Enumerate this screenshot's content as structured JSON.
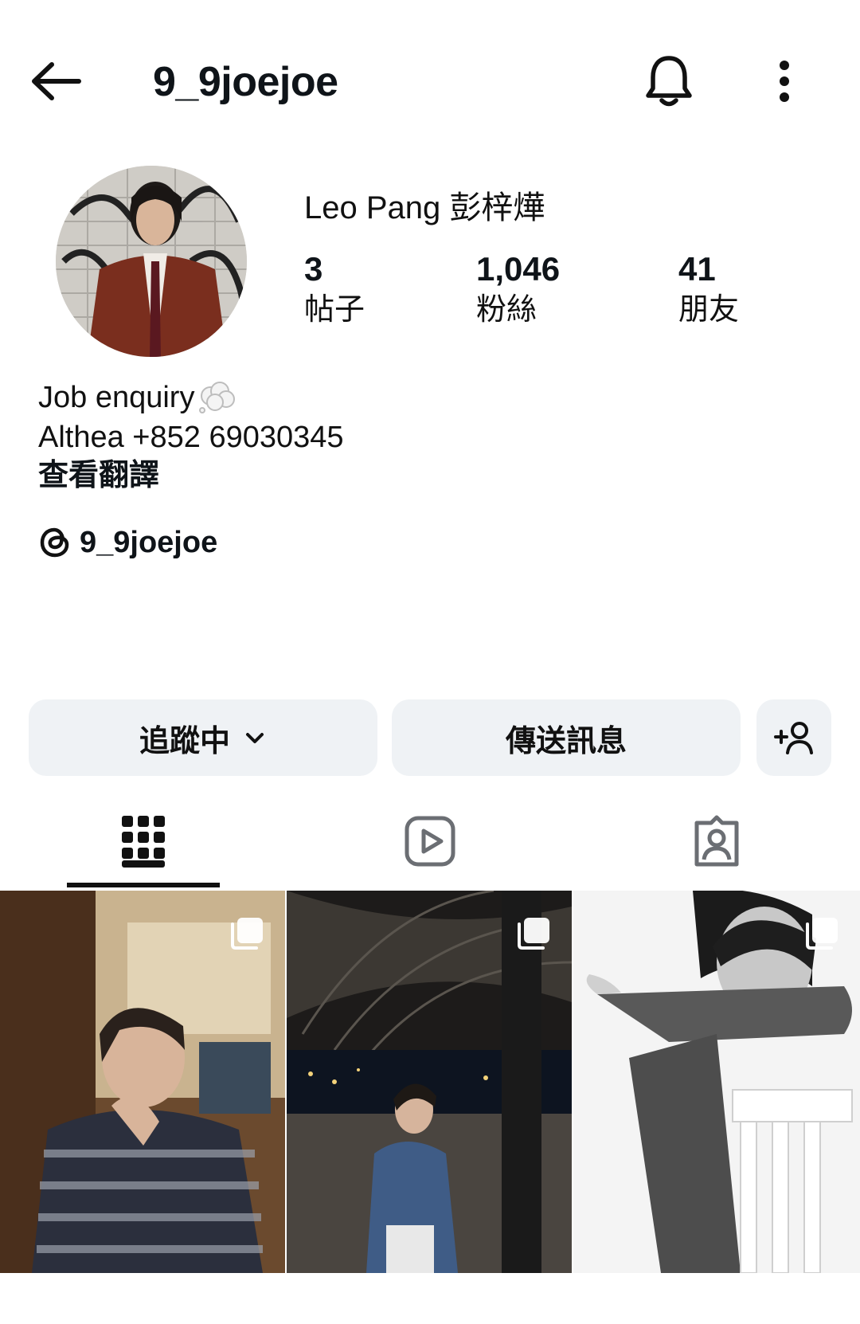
{
  "header": {
    "username": "9_9joejoe",
    "icons": {
      "back": "arrow-left-icon",
      "bell": "bell-icon",
      "more": "more-vertical-icon"
    }
  },
  "profile": {
    "display_name": "Leo Pang 彭梓燁",
    "stats": [
      {
        "value": "3",
        "label": "帖子"
      },
      {
        "value": "1,046",
        "label": "粉絲"
      },
      {
        "value": "41",
        "label": "朋友"
      }
    ],
    "bio_lines": [
      "Job enquiry",
      "Althea +852 69030345"
    ],
    "bio_emoji": "thought-balloon-icon",
    "translate_label": "查看翻譯",
    "threads_handle": "9_9joejoe"
  },
  "actions": {
    "follow_label": "追蹤中",
    "message_label": "傳送訊息"
  },
  "tabs": [
    {
      "icon": "grid-icon",
      "active": true
    },
    {
      "icon": "reels-icon",
      "active": false
    },
    {
      "icon": "tagged-icon",
      "active": false
    }
  ],
  "posts": [
    {
      "multi": true
    },
    {
      "multi": true
    },
    {
      "multi": true
    }
  ]
}
